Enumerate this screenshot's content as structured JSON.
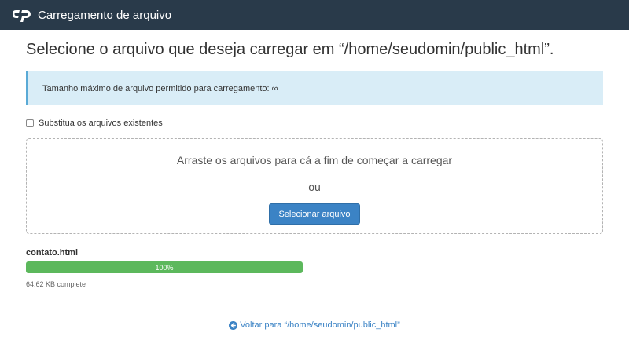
{
  "header": {
    "title": "Carregamento de arquivo",
    "logo_icon": "cpanel-logo-icon",
    "background": "#293a4a"
  },
  "page": {
    "heading": "Selecione o arquivo que deseja carregar em “/home/seudomin/public_html”."
  },
  "alert": {
    "text": "Tamanho máximo de arquivo permitido para carregamento: ∞",
    "background": "#d9edf7"
  },
  "overwrite": {
    "label": "Substitua os arquivos existentes",
    "checked": false
  },
  "dropzone": {
    "text": "Arraste os arquivos para cá a fim de começar a carregar",
    "or": "ou",
    "button_label": "Selecionar arquivo"
  },
  "upload": {
    "file_name": "contato.html",
    "progress_percent": 100,
    "progress_label": "100%",
    "status": "64.62 KB complete",
    "bar_color": "#5cb85c"
  },
  "footer": {
    "back_link": "Voltar para “/home/seudomin/public_html”",
    "back_icon": "arrow-left-circle-icon"
  }
}
